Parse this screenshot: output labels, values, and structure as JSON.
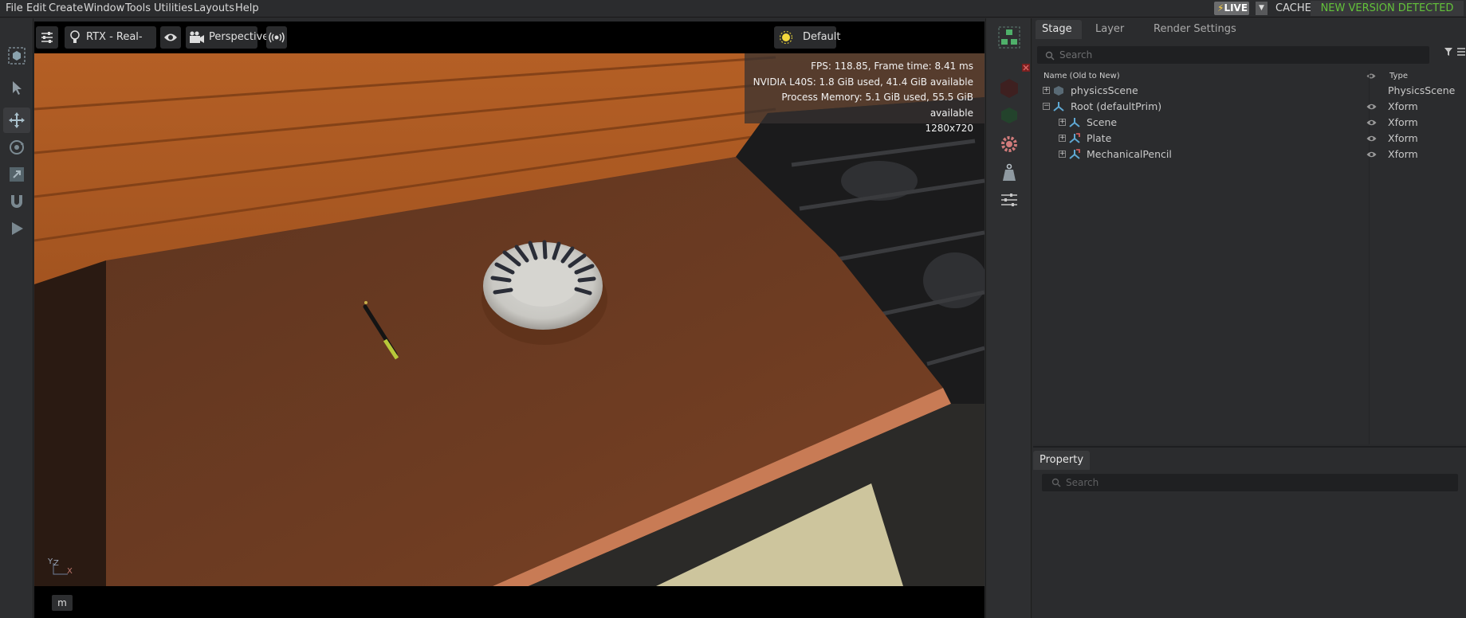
{
  "menubar": {
    "items": [
      "File",
      "Edit",
      "Create",
      "Window",
      "Tools",
      "Utilities",
      "Layouts",
      "Help"
    ],
    "live_label": "LIVE",
    "cache_label": "CACHE:",
    "version_status": "NEW VERSION DETECTED"
  },
  "viewport": {
    "render_mode": "RTX - Real-Time",
    "camera": "Perspective",
    "lighting": "Default",
    "stats": {
      "fps": "FPS: 118.85, Frame time: 8.41 ms",
      "gpu": "NVIDIA L40S: 1.8 GiB used, 41.4 GiB available",
      "process_memory": "Process Memory: 5.1 GiB used, 55.5 GiB available",
      "resolution": "1280x720"
    },
    "axis_labels": {
      "y": "Y",
      "z": "Z",
      "x": "X"
    },
    "unit": "m"
  },
  "stage": {
    "tabs": [
      "Stage",
      "Layer",
      "Render Settings"
    ],
    "search_placeholder": "Search",
    "columns": {
      "name": "Name (Old to New)",
      "type": "Type"
    },
    "rows": [
      {
        "name": "physicsScene",
        "type": "PhysicsScene",
        "icon": "physics-scene-icon"
      },
      {
        "name": "Root (defaultPrim)",
        "type": "Xform",
        "icon": "xform-icon"
      },
      {
        "name": "Scene",
        "type": "Xform",
        "icon": "xform-icon"
      },
      {
        "name": "Plate",
        "type": "Xform",
        "icon": "xform-ref-icon"
      },
      {
        "name": "MechanicalPencil",
        "type": "Xform",
        "icon": "xform-ref-icon"
      }
    ]
  },
  "property": {
    "tab": "Property",
    "search_placeholder": "Search"
  },
  "colors": {
    "accent_green": "#63c23a",
    "live_bolt": "#ffd23f",
    "panel_bg": "#2b2c2e"
  }
}
